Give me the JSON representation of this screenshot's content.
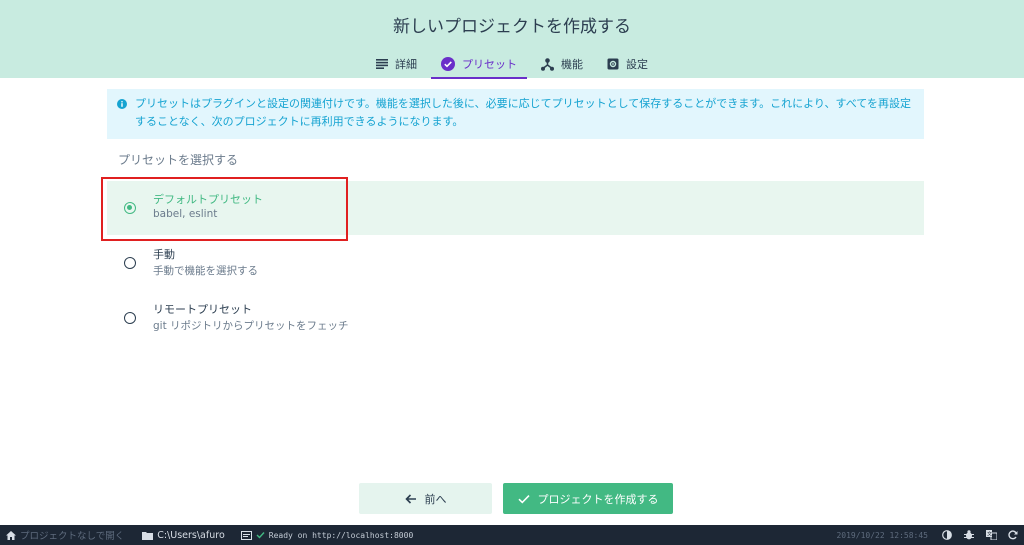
{
  "header": {
    "title": "新しいプロジェクトを作成する",
    "tabs": [
      {
        "label": "詳細",
        "icon": "list-icon",
        "active": false
      },
      {
        "label": "プリセット",
        "icon": "check-circle-icon",
        "active": true
      },
      {
        "label": "機能",
        "icon": "device-hub-icon",
        "active": false
      },
      {
        "label": "設定",
        "icon": "settings-icon",
        "active": false
      }
    ]
  },
  "info": {
    "icon": "info-icon",
    "text": "プリセットはプラグインと設定の関連付けです。機能を選択した後に、必要に応じてプリセットとして保存することができます。これにより、すべてを再設定することなく、次のプロジェクトに再利用できるようになります。"
  },
  "presets": {
    "title": "プリセットを選択する",
    "options": [
      {
        "name": "デフォルトプリセット",
        "description": "babel, eslint",
        "selected": true
      },
      {
        "name": "手動",
        "description": "手動で機能を選択する",
        "selected": false
      },
      {
        "name": "リモートプリセット",
        "description": "git リポジトリからプリセットをフェッチ",
        "selected": false
      }
    ]
  },
  "actions": {
    "prev_label": "前へ",
    "create_label": "プロジェクトを作成する"
  },
  "statusbar": {
    "home_label": "プロジェクトなしで開く",
    "folder_path": "C:\\Users\\afuro",
    "log_message": "Ready on http://localhost:8000",
    "datetime": "2019/10/22 12:58:45"
  },
  "colors": {
    "header_bg": "#c8ebe0",
    "accent_green": "#42b983",
    "tab_active": "#6a2fc9",
    "info_bg": "#e2f6fd",
    "info_text": "#15a3d1",
    "statusbar_bg": "#1d2735",
    "highlight": "#e02020"
  }
}
